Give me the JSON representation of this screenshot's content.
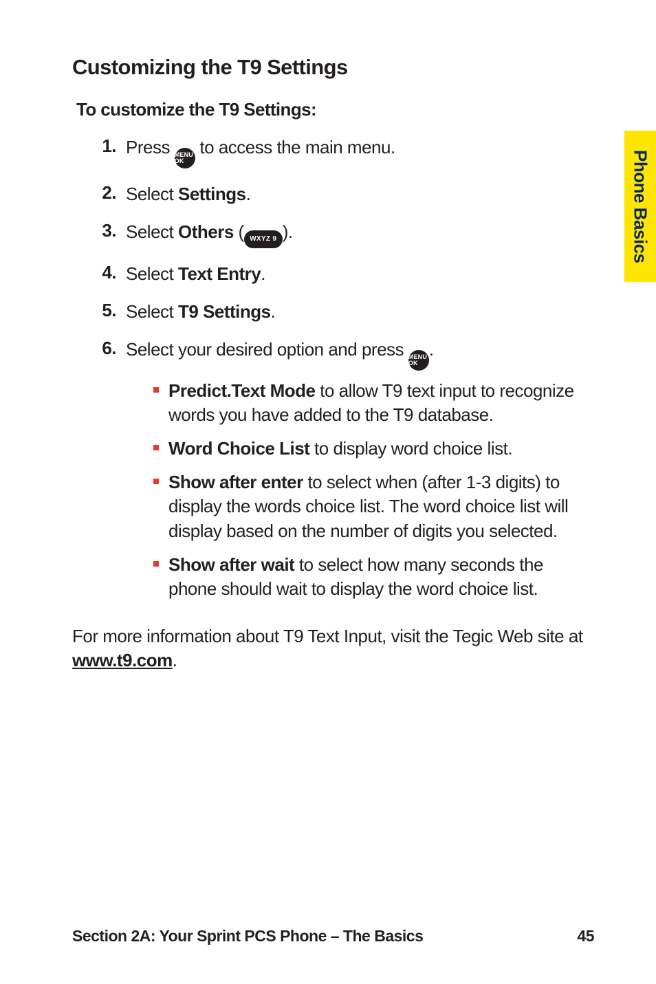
{
  "heading": "Customizing the T9 Settings",
  "lead": "To customize the T9 Settings:",
  "key_menu": "MENU OK",
  "key_wxyz": "WXYZ 9",
  "steps": [
    {
      "num": "1.",
      "pre": "Press ",
      "post": " to access the main menu.",
      "key": "menu"
    },
    {
      "num": "2.",
      "pre": "Select ",
      "bold": "Settings",
      "post": "."
    },
    {
      "num": "3.",
      "pre": "Select ",
      "bold": "Others",
      "post_open": " (",
      "post_close": ").",
      "key": "wxyz"
    },
    {
      "num": "4.",
      "pre": "Select ",
      "bold": "Text Entry",
      "post": "."
    },
    {
      "num": "5.",
      "pre": "Select ",
      "bold": "T9 Settings",
      "post": "."
    },
    {
      "num": "6.",
      "pre": "Select your desired option and press ",
      "post": ".",
      "key": "menu"
    }
  ],
  "subitems": [
    {
      "bold": "Predict.Text Mode",
      "rest": " to allow T9 text input to recognize words you have added to the T9 database."
    },
    {
      "bold": "Word Choice List",
      "rest": " to display word choice list."
    },
    {
      "bold": "Show after enter",
      "rest": " to select when (after 1-3 digits) to display the words choice list. The word choice list will display based on the number of digits you selected."
    },
    {
      "bold": "Show after wait",
      "rest": " to select how many seconds the phone should wait to display the word choice list."
    }
  ],
  "para_pre": "For more information about T9 Text Input, visit the Tegic Web site at ",
  "para_link": "www.t9.com",
  "para_post": ".",
  "tab": "Phone Basics",
  "footer_left": "Section 2A: Your Sprint PCS Phone – The Basics",
  "footer_right": "45"
}
